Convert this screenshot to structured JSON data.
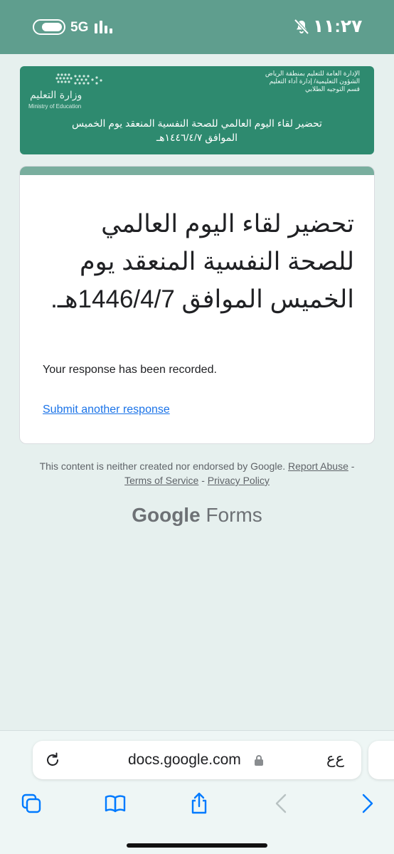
{
  "status_bar": {
    "network": "5G",
    "time": "١١:٢٧"
  },
  "banner": {
    "ministry_ar": "وزارة التعليم",
    "ministry_en": "Ministry of Education",
    "dept_lines": [
      "الإدارة العامة للتعليم بمنطقة الرياض",
      "الشؤون التعليمية/ إدارة أداء التعليم",
      "قسم التوجيه الطلابي"
    ],
    "title": "تحضير لقاء اليوم العالمي للصحة النفسية المنعقد يوم الخميس الموافق ١٤٤٦/٤/٧هـ"
  },
  "card": {
    "title": "تحضير لقاء اليوم العالمي للصحة النفسية المنعقد يوم الخميس الموافق 1446/4/7هـ.",
    "recorded": "Your response has been recorded.",
    "submit_another": "Submit another response"
  },
  "footer": {
    "disclaimer": "This content is neither created nor endorsed by Google.",
    "report_abuse": "Report Abuse",
    "separator": "-",
    "terms": "Terms of Service",
    "privacy": "Privacy Policy",
    "brand_google": "Google",
    "brand_forms": "Forms"
  },
  "browser": {
    "url": "docs.google.com",
    "text_size": "ﻉﻉ"
  },
  "icons": {
    "reload": "reload-icon",
    "lock": "lock-icon",
    "tabs": "tabs-icon",
    "bookmarks": "bookmarks-icon",
    "share": "share-icon",
    "back": "back-chevron-icon",
    "forward": "forward-chevron-icon",
    "mute": "bell-slash-icon"
  },
  "colors": {
    "header_green": "#5f9e8e",
    "banner_green": "#2e8a6f",
    "link_blue": "#1a73e8",
    "ios_blue": "#007aff"
  }
}
